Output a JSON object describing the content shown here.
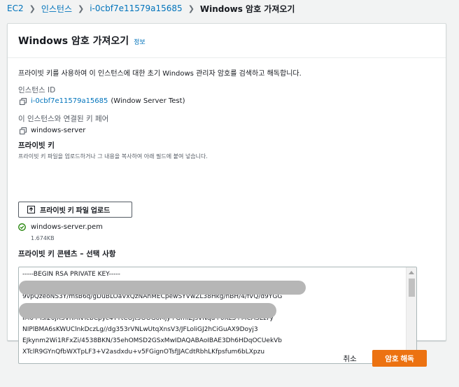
{
  "breadcrumb": {
    "items": [
      "EC2",
      "인스턴스",
      "i-0cbf7e11579a15685"
    ],
    "current": "Windows 암호 가져오기"
  },
  "panel": {
    "title": "Windows 암호 가져오기",
    "info_link": "정보",
    "description": "프라이빗 키를 사용하여 이 인스턴스에 대한 초기 Windows 관리자 암호를 검색하고 해독합니다.",
    "instance_id_label": "인스턴스 ID",
    "instance_id": "i-0cbf7e11579a15685",
    "instance_name": "(Window Server Test)",
    "key_pair_label": "이 인스턴스와 연결된 키 페어",
    "key_pair_name": "windows-server",
    "private_key_label": "프라이빗 키",
    "private_key_hint": "프라이빗 키 파일을 업로드하거나 그 내용을 복사하여 아래 필드에 붙여 넣습니다.",
    "upload_button": "프라이빗 키 파일 업로드",
    "uploaded_file": "windows-server.pem",
    "uploaded_file_size": "1.674KB",
    "content_label": "프라이빗 키 콘텐츠 – 선택 사항",
    "key_content_lines": [
      "-----BEGIN RSA PRIVATE KEY-----",
      "",
      "9vpQzeoNS3Y/msB6q/gDuBLOaVxQzNAhMECpewSYVwZL38Hkg/nBH/4/fVQ/d9YGG",
      "",
      "IM0+Tsi26jXSVnMNTcbCpyc4YTtCOJt5OOGoMjy+GmiZJsVNqu+0KLS+MCASEzFy",
      "NIPlBMA6sKWUClnkDczLg//dg353rVNLwUtqXnsV3/JFLoliGJ2hCiGuAX9Doyj3",
      "EJkynm2Wi1RFxZi/4538BKN/35ehOMSD2GSxMwIDAQABAoIBAE3Dh6HDqOCUekVb",
      "XTclR9GYnQfbWXTpLF3+V2asdxdu+v5FGignOTsfJJACdtRbhLKfpsfum6bLXpzu"
    ]
  },
  "footer": {
    "cancel": "취소",
    "decrypt": "암호 해독"
  },
  "colors": {
    "link": "#0073bb",
    "primary": "#ec7211",
    "success": "#1d8102"
  }
}
